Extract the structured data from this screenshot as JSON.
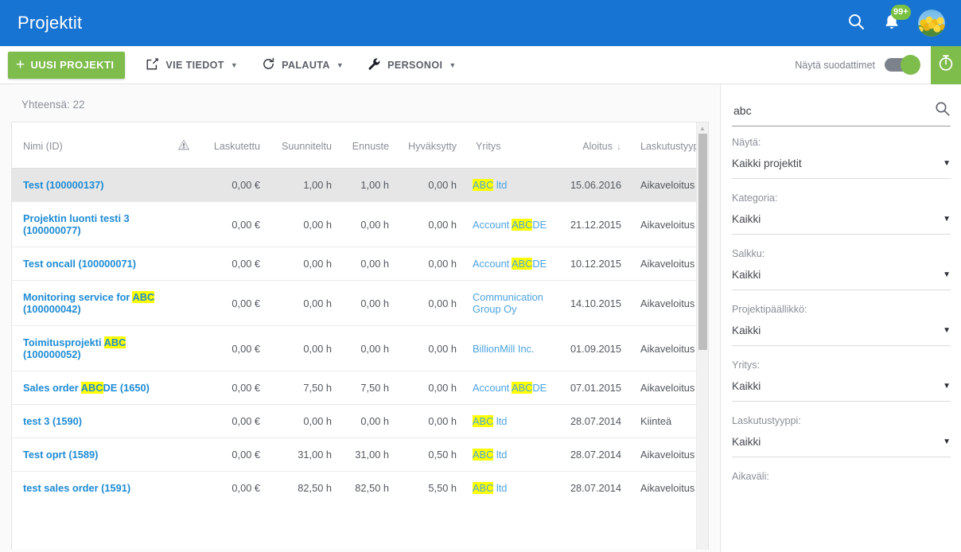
{
  "appbar": {
    "title": "Projektit",
    "search_icon": "search-icon",
    "bell_icon": "bell-icon",
    "badge": "99+",
    "avatar": "user-avatar"
  },
  "toolbar": {
    "new_project": "UUSI PROJEKTI",
    "export": "VIE TIEDOT",
    "restore": "PALAUTA",
    "personalize": "PERSONOI",
    "show_filters_label": "Näytä suodattimet",
    "toggle_state": "on",
    "timer_icon": "stopwatch-icon"
  },
  "content": {
    "total_label": "Yhteensä: 22"
  },
  "table": {
    "columns": [
      {
        "key": "name",
        "label": "Nimi (ID)"
      },
      {
        "key": "warn",
        "label": ""
      },
      {
        "key": "billed",
        "label": "Laskutettu"
      },
      {
        "key": "plan",
        "label": "Suunniteltu"
      },
      {
        "key": "fcast",
        "label": "Ennuste"
      },
      {
        "key": "appr",
        "label": "Hyväksytty"
      },
      {
        "key": "firm",
        "label": "Yritys"
      },
      {
        "key": "start",
        "label": "Aloitus"
      },
      {
        "key": "btype",
        "label": "Laskutustyyppi"
      }
    ],
    "sort_column": "Aloitus",
    "sort_direction": "↓",
    "highlight_term": "ABC",
    "rows": [
      {
        "selected": true,
        "name_pre": "Test (100000137)",
        "name_hl": "",
        "name_post": "",
        "billed": "0,00 €",
        "plan": "1,00 h",
        "fcast": "1,00 h",
        "appr": "0,00 h",
        "firm_pre": "",
        "firm_hl": "ABC",
        "firm_post": " ltd",
        "start": "15.06.2016",
        "btype": "Aikaveloitus"
      },
      {
        "selected": false,
        "name_pre": "Projektin luonti testi 3 (100000077)",
        "name_hl": "",
        "name_post": "",
        "billed": "0,00 €",
        "plan": "0,00 h",
        "fcast": "0,00 h",
        "appr": "0,00 h",
        "firm_pre": "Account ",
        "firm_hl": "ABC",
        "firm_post": "DE",
        "start": "21.12.2015",
        "btype": "Aikaveloitus"
      },
      {
        "selected": false,
        "name_pre": "Test oncall (100000071)",
        "name_hl": "",
        "name_post": "",
        "billed": "0,00 €",
        "plan": "0,00 h",
        "fcast": "0,00 h",
        "appr": "0,00 h",
        "firm_pre": "Account ",
        "firm_hl": "ABC",
        "firm_post": "DE",
        "start": "10.12.2015",
        "btype": "Aikaveloitus"
      },
      {
        "selected": false,
        "name_pre": "Monitoring service for ",
        "name_hl": "ABC",
        "name_post": " (100000042)",
        "billed": "0,00 €",
        "plan": "0,00 h",
        "fcast": "0,00 h",
        "appr": "0,00 h",
        "firm_pre": "Communication Group Oy",
        "firm_hl": "",
        "firm_post": "",
        "start": "14.10.2015",
        "btype": "Aikaveloitus"
      },
      {
        "selected": false,
        "name_pre": "Toimitusprojekti ",
        "name_hl": "ABC",
        "name_post": " (100000052)",
        "billed": "0,00 €",
        "plan": "0,00 h",
        "fcast": "0,00 h",
        "appr": "0,00 h",
        "firm_pre": "BillionMill Inc.",
        "firm_hl": "",
        "firm_post": "",
        "start": "01.09.2015",
        "btype": "Aikaveloitus"
      },
      {
        "selected": false,
        "name_pre": "Sales order ",
        "name_hl": "ABC",
        "name_post": "DE (1650)",
        "billed": "0,00 €",
        "plan": "7,50 h",
        "fcast": "7,50 h",
        "appr": "0,00 h",
        "firm_pre": "Account ",
        "firm_hl": "ABC",
        "firm_post": "DE",
        "start": "07.01.2015",
        "btype": "Aikaveloitus"
      },
      {
        "selected": false,
        "name_pre": "test 3 (1590)",
        "name_hl": "",
        "name_post": "",
        "billed": "0,00 €",
        "plan": "0,00 h",
        "fcast": "0,00 h",
        "appr": "0,00 h",
        "firm_pre": "",
        "firm_hl": "ABC",
        "firm_post": " ltd",
        "start": "28.07.2014",
        "btype": "Kiinteä"
      },
      {
        "selected": false,
        "name_pre": "Test oprt (1589)",
        "name_hl": "",
        "name_post": "",
        "billed": "0,00 €",
        "plan": "31,00 h",
        "fcast": "31,00 h",
        "appr": "0,50 h",
        "firm_pre": "",
        "firm_hl": "ABC",
        "firm_post": " ltd",
        "start": "28.07.2014",
        "btype": "Aikaveloitus"
      },
      {
        "selected": false,
        "name_pre": "test sales order (1591)",
        "name_hl": "",
        "name_post": "",
        "billed": "0,00 €",
        "plan": "82,50 h",
        "fcast": "82,50 h",
        "appr": "5,50 h",
        "firm_pre": "",
        "firm_hl": "ABC",
        "firm_post": " ltd",
        "start": "28.07.2014",
        "btype": "Aikaveloitus"
      }
    ]
  },
  "filters": {
    "search_value": "abc",
    "search_placeholder": "",
    "search_icon": "search-icon",
    "groups": [
      {
        "label": "Näytä:",
        "value": "Kaikki projektit"
      },
      {
        "label": "Kategoria:",
        "value": "Kaikki"
      },
      {
        "label": "Salkku:",
        "value": "Kaikki"
      },
      {
        "label": "Projektipäällikkö:",
        "value": "Kaikki"
      },
      {
        "label": "Yritys:",
        "value": "Kaikki"
      },
      {
        "label": "Laskutustyyppi:",
        "value": "Kaikki"
      }
    ],
    "last_label": "Aikaväli:"
  },
  "colors": {
    "brand_blue": "#1874d2",
    "accent_green": "#7ebc4c",
    "link_blue": "#1e8bd4",
    "highlight_yellow": "#ffff00"
  }
}
